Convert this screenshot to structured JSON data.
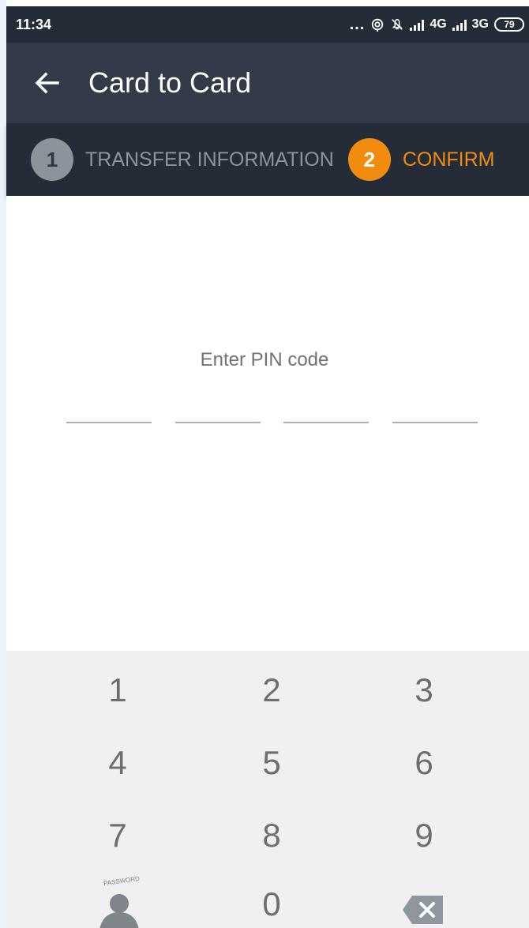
{
  "status_bar": {
    "time": "11:34",
    "dots": "...",
    "network_1": "4G",
    "network_2": "3G",
    "battery": "79",
    "icons": [
      "three-dots-icon",
      "hotspot-icon",
      "mute-icon",
      "signal-icon",
      "signal-icon",
      "battery-icon"
    ]
  },
  "app_bar": {
    "title": "Card to Card",
    "back_icon": "arrow-left-icon"
  },
  "stepper": {
    "steps": [
      {
        "number": "1",
        "label": "TRANSFER INFORMATION",
        "state": "completed",
        "color": "#8d939a"
      },
      {
        "number": "2",
        "label": "CONFIRM",
        "state": "active",
        "color": "#f28c0f"
      }
    ]
  },
  "pin": {
    "label": "Enter PIN code",
    "slots": 4,
    "entered": 0
  },
  "keypad": {
    "keys": [
      "1",
      "2",
      "3",
      "4",
      "5",
      "6",
      "7",
      "8",
      "9",
      "0"
    ],
    "password_label": "PASSWORD",
    "password_icon": "user-icon",
    "delete_icon": "backspace-icon"
  },
  "colors": {
    "status_background": "#242c37",
    "app_bar_background": "#323b47",
    "accent": "#f28c0f",
    "keypad_background": "#f0f0f0"
  }
}
